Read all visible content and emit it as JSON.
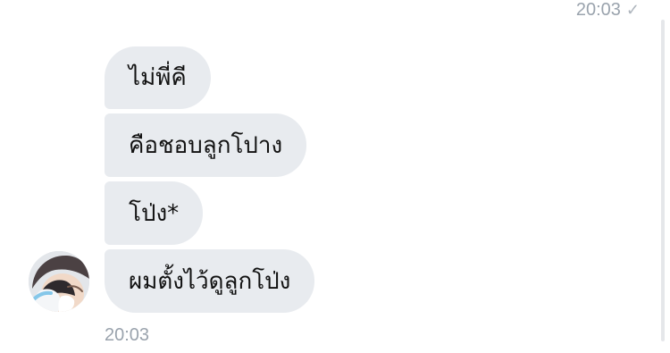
{
  "chat": {
    "outgoing_time": "20:03",
    "outgoing_status_icon": "check-icon",
    "messages": [
      {
        "text": "ไม่พี่คี"
      },
      {
        "text": "คือชอบลูกโปาง"
      },
      {
        "text": "โป่ง*"
      },
      {
        "text": "ผมตั้งไว้ดูลูกโป่ง"
      }
    ],
    "incoming_time": "20:03",
    "avatar": {
      "kind": "user-photo"
    }
  }
}
